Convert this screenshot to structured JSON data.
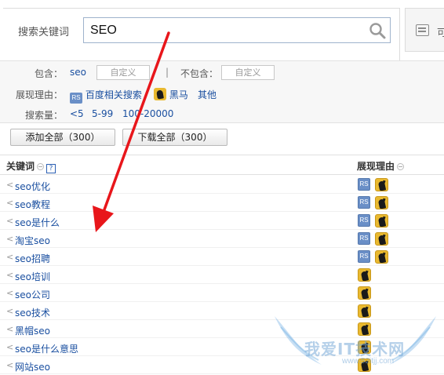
{
  "search": {
    "label": "搜索关键词",
    "value": "SEO"
  },
  "right_tab": {
    "label": "可"
  },
  "filters": {
    "include_label": "包含：",
    "include_value": "seo",
    "custom_button": "自定义",
    "separator": "|",
    "exclude_label": "不包含：",
    "exclude_custom_button": "自定义",
    "reason_label": "展现理由：",
    "reasons": [
      {
        "icon": "rs-icon",
        "label": "百度相关搜索",
        "badge": "RS"
      },
      {
        "icon": "black-horse-icon",
        "label": "黑马"
      },
      {
        "icon": "",
        "label": "其他"
      }
    ],
    "volume_label": "搜索量：",
    "volume_options": [
      "<5",
      "5-99",
      "100-20000"
    ]
  },
  "actions": {
    "add_all": "添加全部（300）",
    "download_all": "下载全部（300）"
  },
  "table": {
    "col_keyword": "关键词",
    "col_reason": "展现理由",
    "help_mark": "?",
    "rs_badge": "RS",
    "rows": [
      {
        "keyword": "seo优化",
        "rs": true,
        "horse": true
      },
      {
        "keyword": "seo教程",
        "rs": true,
        "horse": true
      },
      {
        "keyword": "seo是什么",
        "rs": true,
        "horse": true
      },
      {
        "keyword": "淘宝seo",
        "rs": true,
        "horse": true
      },
      {
        "keyword": "seo招聘",
        "rs": true,
        "horse": true
      },
      {
        "keyword": "seo培训",
        "rs": false,
        "horse": true
      },
      {
        "keyword": "seo公司",
        "rs": false,
        "horse": true
      },
      {
        "keyword": "seo技术",
        "rs": false,
        "horse": true
      },
      {
        "keyword": "黑帽seo",
        "rs": false,
        "horse": true
      },
      {
        "keyword": "seo是什么意思",
        "rs": false,
        "horse": true
      },
      {
        "keyword": "网站seo",
        "rs": false,
        "horse": true
      }
    ]
  },
  "watermark": {
    "text": "我爱IT技术网",
    "url": "www.52itjj.com"
  },
  "colors": {
    "link": "#1a4fa0",
    "rs_badge": "#6a8fc7",
    "horse_badge": "#e9b930",
    "annotation_arrow": "#e8161b"
  }
}
